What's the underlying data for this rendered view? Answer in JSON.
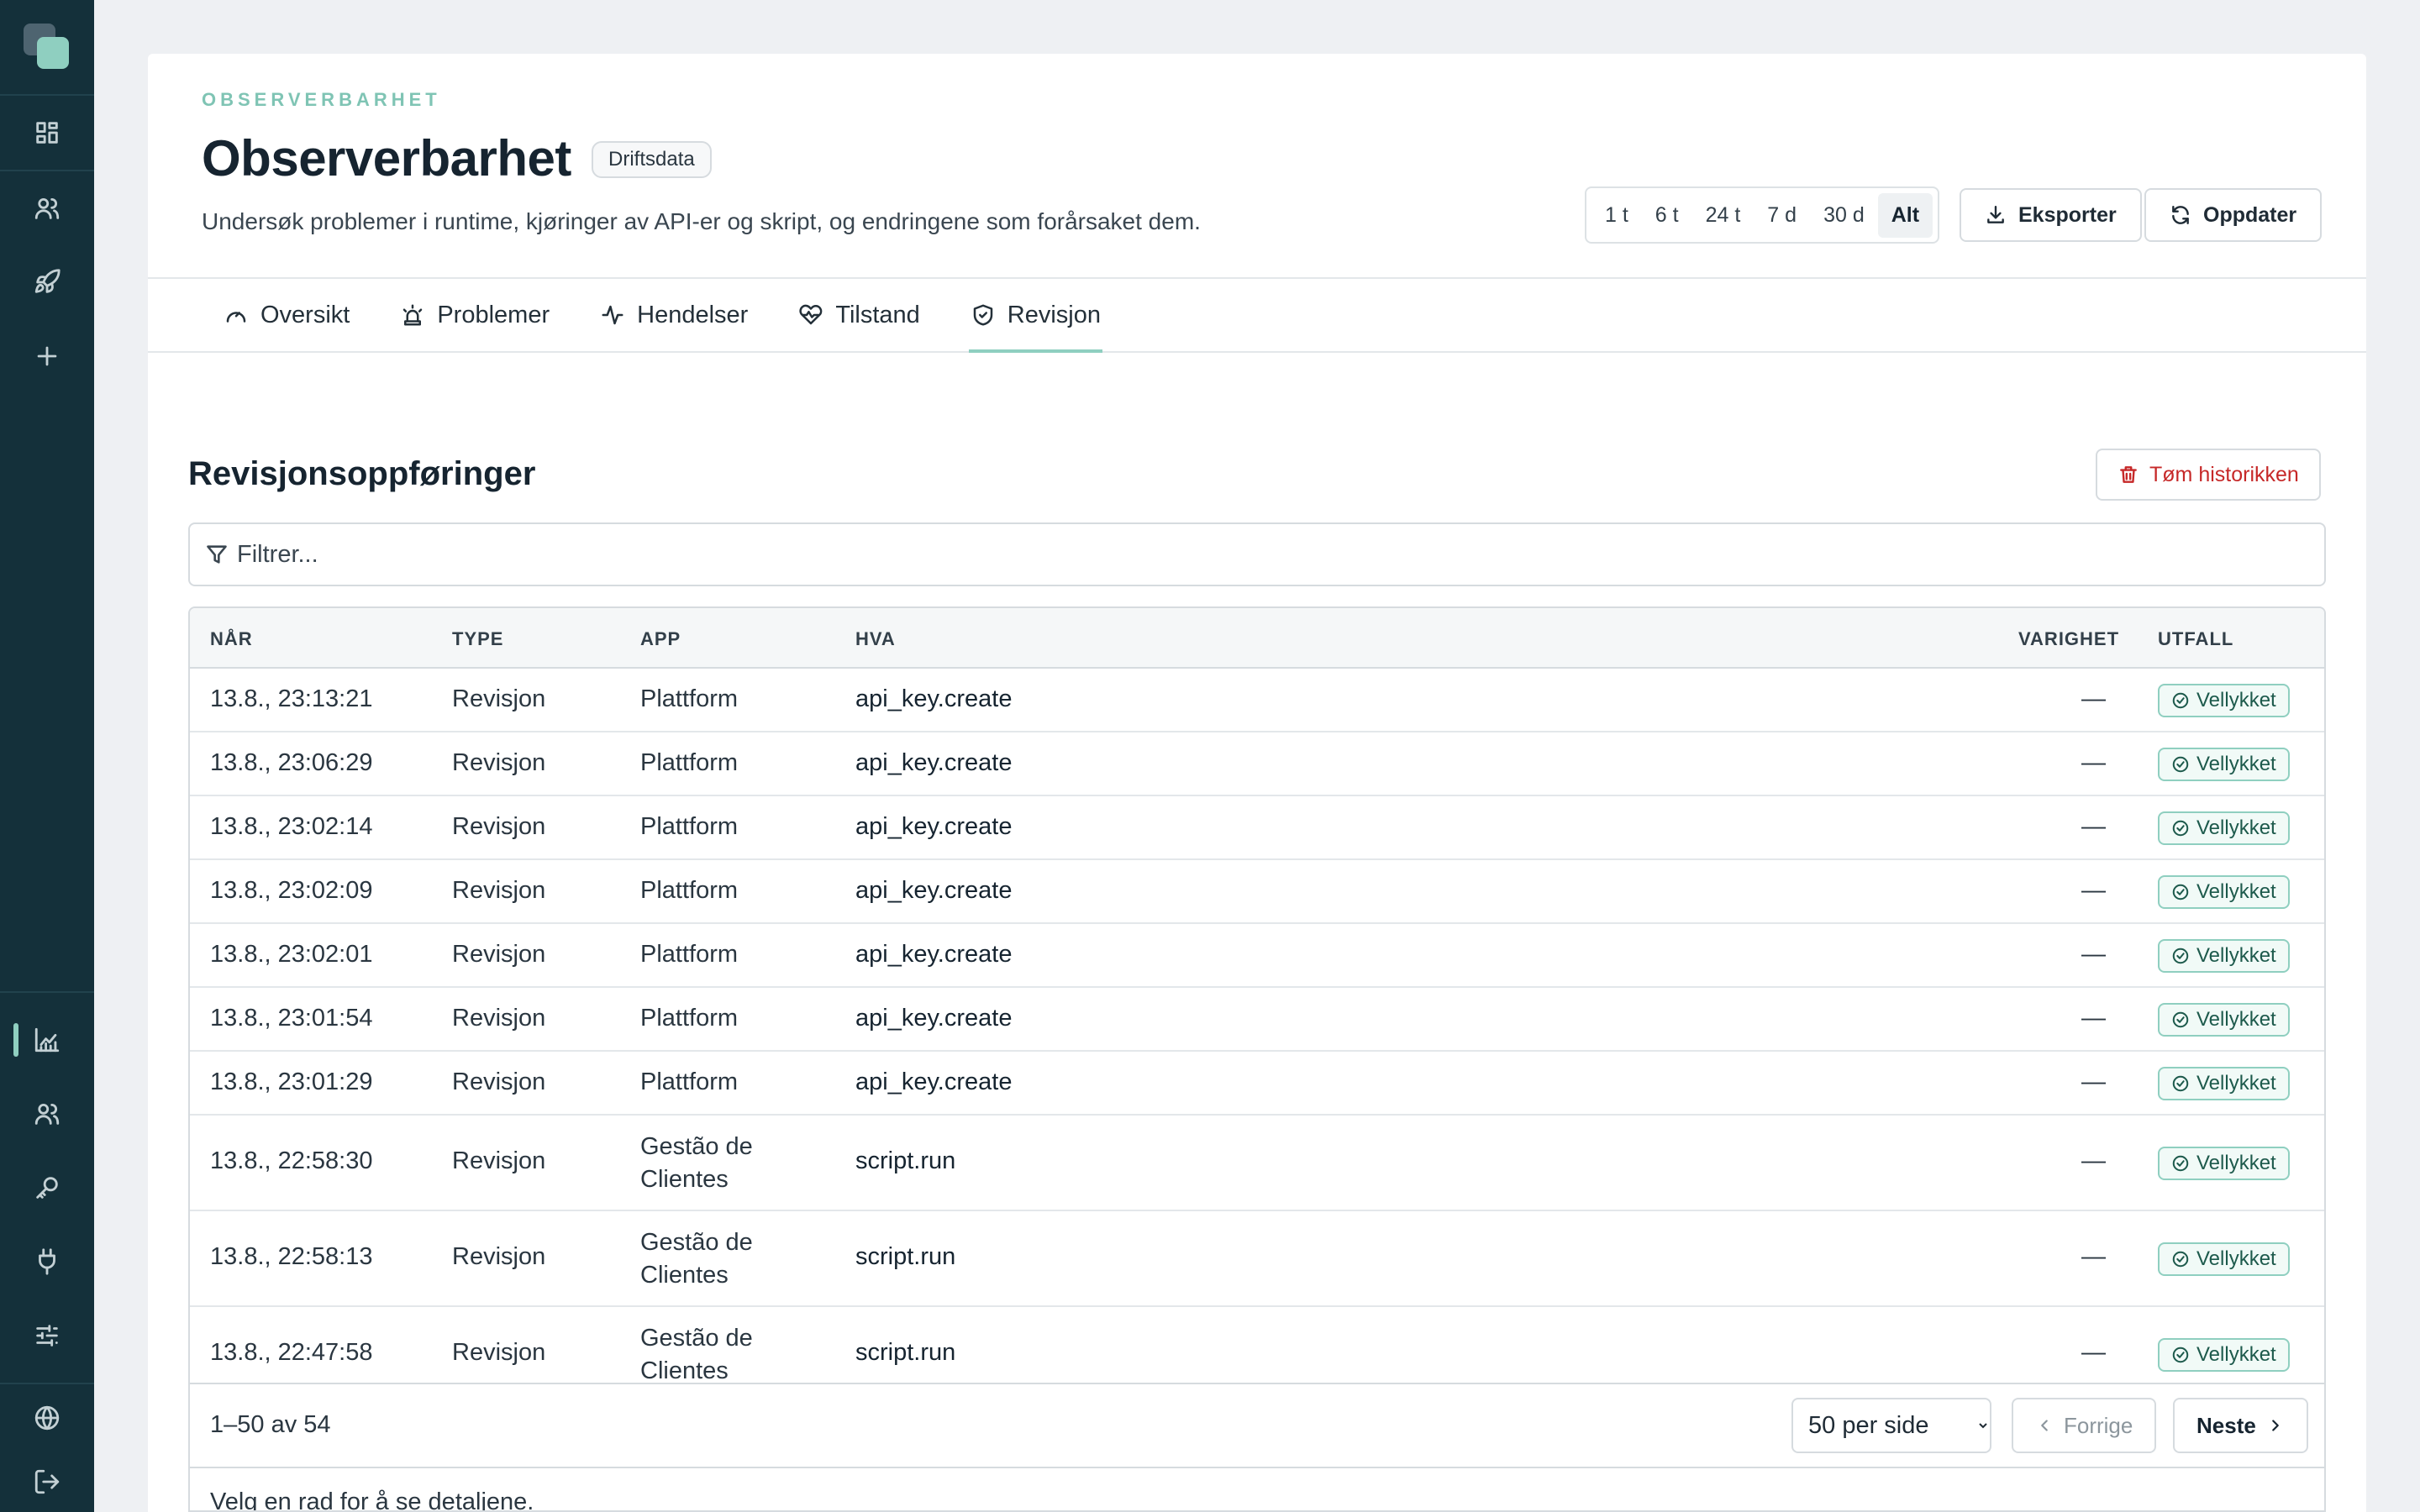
{
  "sidebar": {
    "top_icons": [
      "dashboard-icon",
      "users-icon",
      "rocket-icon",
      "plus-icon"
    ],
    "bottom_icons": [
      "chart-icon",
      "users-icon",
      "key-icon",
      "plug-icon",
      "sliders-icon"
    ],
    "footer_icons": [
      "globe-icon",
      "logout-icon"
    ],
    "active": "chart-icon"
  },
  "header": {
    "eyebrow": "OBSERVERBARHET",
    "title": "Observerbarhet",
    "badge": "Driftsdata",
    "subtitle": "Undersøk problemer i runtime, kjøringer av API-er og skript, og endringene som forårsaket dem.",
    "ranges": [
      "1 t",
      "6 t",
      "24 t",
      "7 d",
      "30 d",
      "Alt"
    ],
    "selected_range": "Alt",
    "export_label": "Eksporter",
    "refresh_label": "Oppdater"
  },
  "tabs": [
    {
      "label": "Oversikt",
      "icon": "gauge-icon"
    },
    {
      "label": "Problemer",
      "icon": "siren-icon"
    },
    {
      "label": "Hendelser",
      "icon": "activity-icon"
    },
    {
      "label": "Tilstand",
      "icon": "heart-pulse-icon"
    },
    {
      "label": "Revisjon",
      "icon": "shield-check-icon"
    }
  ],
  "active_tab": "Revisjon",
  "section": {
    "title": "Revisjonsoppføringer",
    "clear_label": "Tøm historikken",
    "filter_placeholder": "Filtrer..."
  },
  "table": {
    "columns": [
      "NÅR",
      "TYPE",
      "APP",
      "HVA",
      "VARIGHET",
      "UTFALL"
    ],
    "rows": [
      {
        "when": "13.8., 23:13:21",
        "type": "Revisjon",
        "app": "Plattform",
        "what": "api_key.create",
        "duration": "—",
        "status": "Vellykket"
      },
      {
        "when": "13.8., 23:06:29",
        "type": "Revisjon",
        "app": "Plattform",
        "what": "api_key.create",
        "duration": "—",
        "status": "Vellykket"
      },
      {
        "when": "13.8., 23:02:14",
        "type": "Revisjon",
        "app": "Plattform",
        "what": "api_key.create",
        "duration": "—",
        "status": "Vellykket"
      },
      {
        "when": "13.8., 23:02:09",
        "type": "Revisjon",
        "app": "Plattform",
        "what": "api_key.create",
        "duration": "—",
        "status": "Vellykket"
      },
      {
        "when": "13.8., 23:02:01",
        "type": "Revisjon",
        "app": "Plattform",
        "what": "api_key.create",
        "duration": "—",
        "status": "Vellykket"
      },
      {
        "when": "13.8., 23:01:54",
        "type": "Revisjon",
        "app": "Plattform",
        "what": "api_key.create",
        "duration": "—",
        "status": "Vellykket"
      },
      {
        "when": "13.8., 23:01:29",
        "type": "Revisjon",
        "app": "Plattform",
        "what": "api_key.create",
        "duration": "—",
        "status": "Vellykket"
      },
      {
        "when": "13.8., 22:58:30",
        "type": "Revisjon",
        "app": "Gestão de Clientes",
        "what": "script.run",
        "duration": "—",
        "status": "Vellykket"
      },
      {
        "when": "13.8., 22:58:13",
        "type": "Revisjon",
        "app": "Gestão de Clientes",
        "what": "script.run",
        "duration": "—",
        "status": "Vellykket"
      },
      {
        "when": "13.8., 22:47:58",
        "type": "Revisjon",
        "app": "Gestão de Clientes",
        "what": "script.run",
        "duration": "—",
        "status": "Vellykket"
      }
    ]
  },
  "pagination": {
    "count": "1–50 av 54",
    "per_page": "50 per side",
    "prev_label": "Forrige",
    "next_label": "Neste"
  },
  "detail_hint": "Velg en rad for å se detaljene.",
  "colors": {
    "sidebar_bg": "#14303a",
    "accent": "#8fcfc0",
    "danger": "#c62828"
  }
}
